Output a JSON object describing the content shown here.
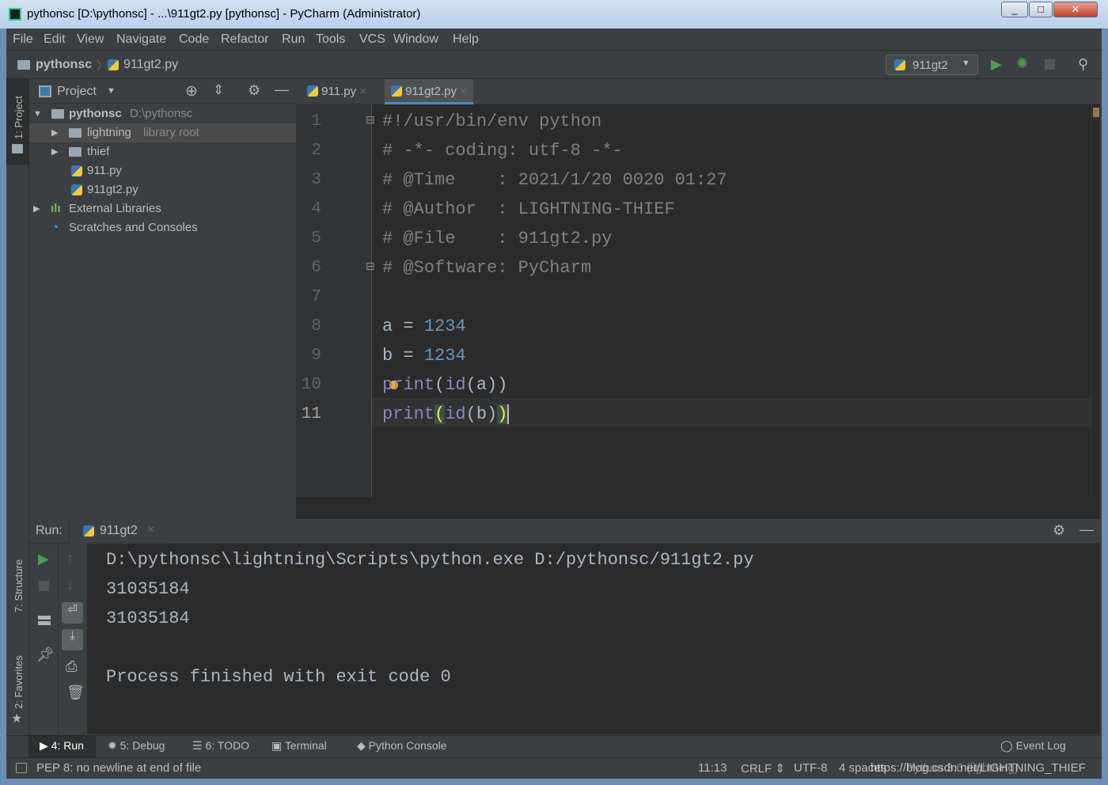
{
  "window": {
    "title": "pythonsc [D:\\pythonsc] - ...\\911gt2.py [pythonsc] - PyCharm (Administrator)"
  },
  "menu": [
    "File",
    "Edit",
    "View",
    "Navigate",
    "Code",
    "Refactor",
    "Run",
    "Tools",
    "VCS",
    "Window",
    "Help"
  ],
  "navbar": {
    "project": "pythonsc",
    "file": "911gt2.py",
    "run_config": "911gt2"
  },
  "side_tabs": {
    "project": "1: Project",
    "structure": "7: Structure",
    "favorites": "2: Favorites"
  },
  "project_panel": {
    "title": "Project",
    "tree": [
      {
        "name": "pythonsc",
        "hint": "D:\\pythonsc"
      },
      {
        "name": "lightning",
        "hint": "library root"
      },
      {
        "name": "thief"
      },
      {
        "name": "911.py"
      },
      {
        "name": "911gt2.py"
      },
      {
        "name": "External Libraries"
      },
      {
        "name": "Scratches and Consoles"
      }
    ]
  },
  "editor": {
    "tabs": [
      {
        "label": "911.py",
        "active": false
      },
      {
        "label": "911gt2.py",
        "active": true
      }
    ],
    "lines": [
      "#!/usr/bin/env python",
      "# -*- coding: utf-8 -*-",
      "# @Time    : 2021/1/20 0020 01:27",
      "# @Author  : LIGHTNING-THIEF",
      "# @File    : 911gt2.py",
      "# @Software: PyCharm",
      "",
      "a = 1234",
      "b = 1234",
      "print(id(a))",
      "print(id(b))"
    ],
    "line_numbers": [
      "1",
      "2",
      "3",
      "4",
      "5",
      "6",
      "7",
      "8",
      "9",
      "10",
      "11"
    ],
    "code_tokens": {
      "a": "a",
      "b": "b",
      "eq": " = ",
      "n": "1234",
      "print": "print",
      "id": "id",
      "pa": "(a)",
      "pb": "(b)",
      "open": "(",
      "close": ")"
    }
  },
  "run_panel": {
    "label": "Run:",
    "tab": "911gt2",
    "output": [
      "D:\\pythonsc\\lightning\\Scripts\\python.exe D:/pythonsc/911gt2.py",
      "31035184",
      "31035184",
      "",
      "Process finished with exit code 0"
    ]
  },
  "bottom_tabs": [
    "4: Run",
    "5: Debug",
    "6: TODO",
    "Terminal",
    "Python Console"
  ],
  "event_log": "Event Log",
  "status": {
    "message": "PEP 8: no newline at end of file",
    "position": "11:13",
    "line_sep": "CRLF",
    "encoding": "UTF-8",
    "indent": "4 spaces",
    "interpreter": "Python 3.6 (lightning)"
  },
  "watermark": "https://blog.csdn.net/LIGHTNING_THIEF",
  "colors": {
    "run": "#499c54",
    "debug": "#499c54",
    "accent": "#4a88c7"
  }
}
